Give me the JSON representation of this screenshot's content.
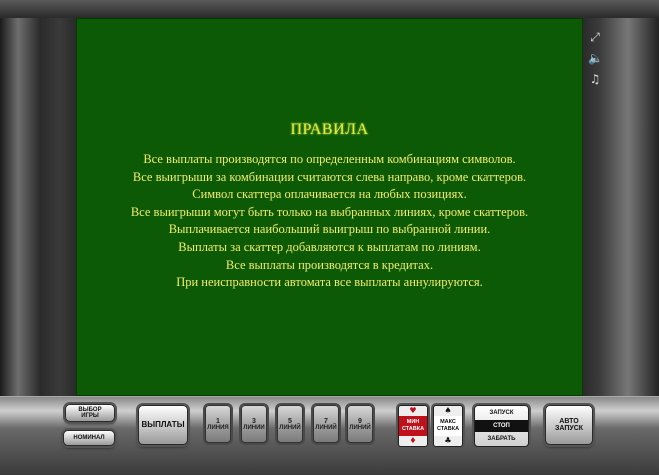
{
  "side_icons": [
    {
      "name": "fullscreen-icon",
      "glyph": "⤢"
    },
    {
      "name": "sound-icon",
      "glyph": "🔈"
    },
    {
      "name": "music-icon",
      "glyph": "♫"
    }
  ],
  "rules": {
    "title": "ПРАВИЛА",
    "lines": [
      "Все выплаты производятся по определенным комбинациям символов.",
      "Все выигрыши за комбинации считаются слева направо, кроме скаттеров.",
      "Символ скаттера оплачивается на любых позициях.",
      "Все выигрыши могут быть только на выбранных линиях, кроме скаттеров.",
      "Выплачивается наибольший выигрыш по выбранной линии.",
      "Выплаты за скаттер добавляются к выплатам по линиям.",
      "Все выплаты производятся в кредитах.",
      "При неисправности автомата все выплаты аннулируются."
    ]
  },
  "controls": {
    "choose_game_1": "ВЫБОР",
    "choose_game_2": "ИГРЫ",
    "nominal": "НОМИНАЛ",
    "payouts": "ВЫПЛАТЫ",
    "lines": [
      {
        "num": "1",
        "label": "ЛИНИЯ"
      },
      {
        "num": "3",
        "label": "ЛИНИИ"
      },
      {
        "num": "5",
        "label": "ЛИНИЙ"
      },
      {
        "num": "7",
        "label": "ЛИНИЙ"
      },
      {
        "num": "9",
        "label": "ЛИНИЙ"
      }
    ],
    "min_bet_1": "МИН",
    "min_bet_2": "СТАВКА",
    "max_bet_1": "МАКС",
    "max_bet_2": "СТАВКА",
    "start": "ЗАПУСК",
    "stop": "СТОП",
    "take": "ЗАБРАТЬ",
    "auto_1": "АВТО",
    "auto_2": "ЗАПУСК"
  },
  "colors": {
    "screen": "#0d5a06",
    "rules_text": "#f3ec6a",
    "min_bet_red": "#c0101a"
  }
}
